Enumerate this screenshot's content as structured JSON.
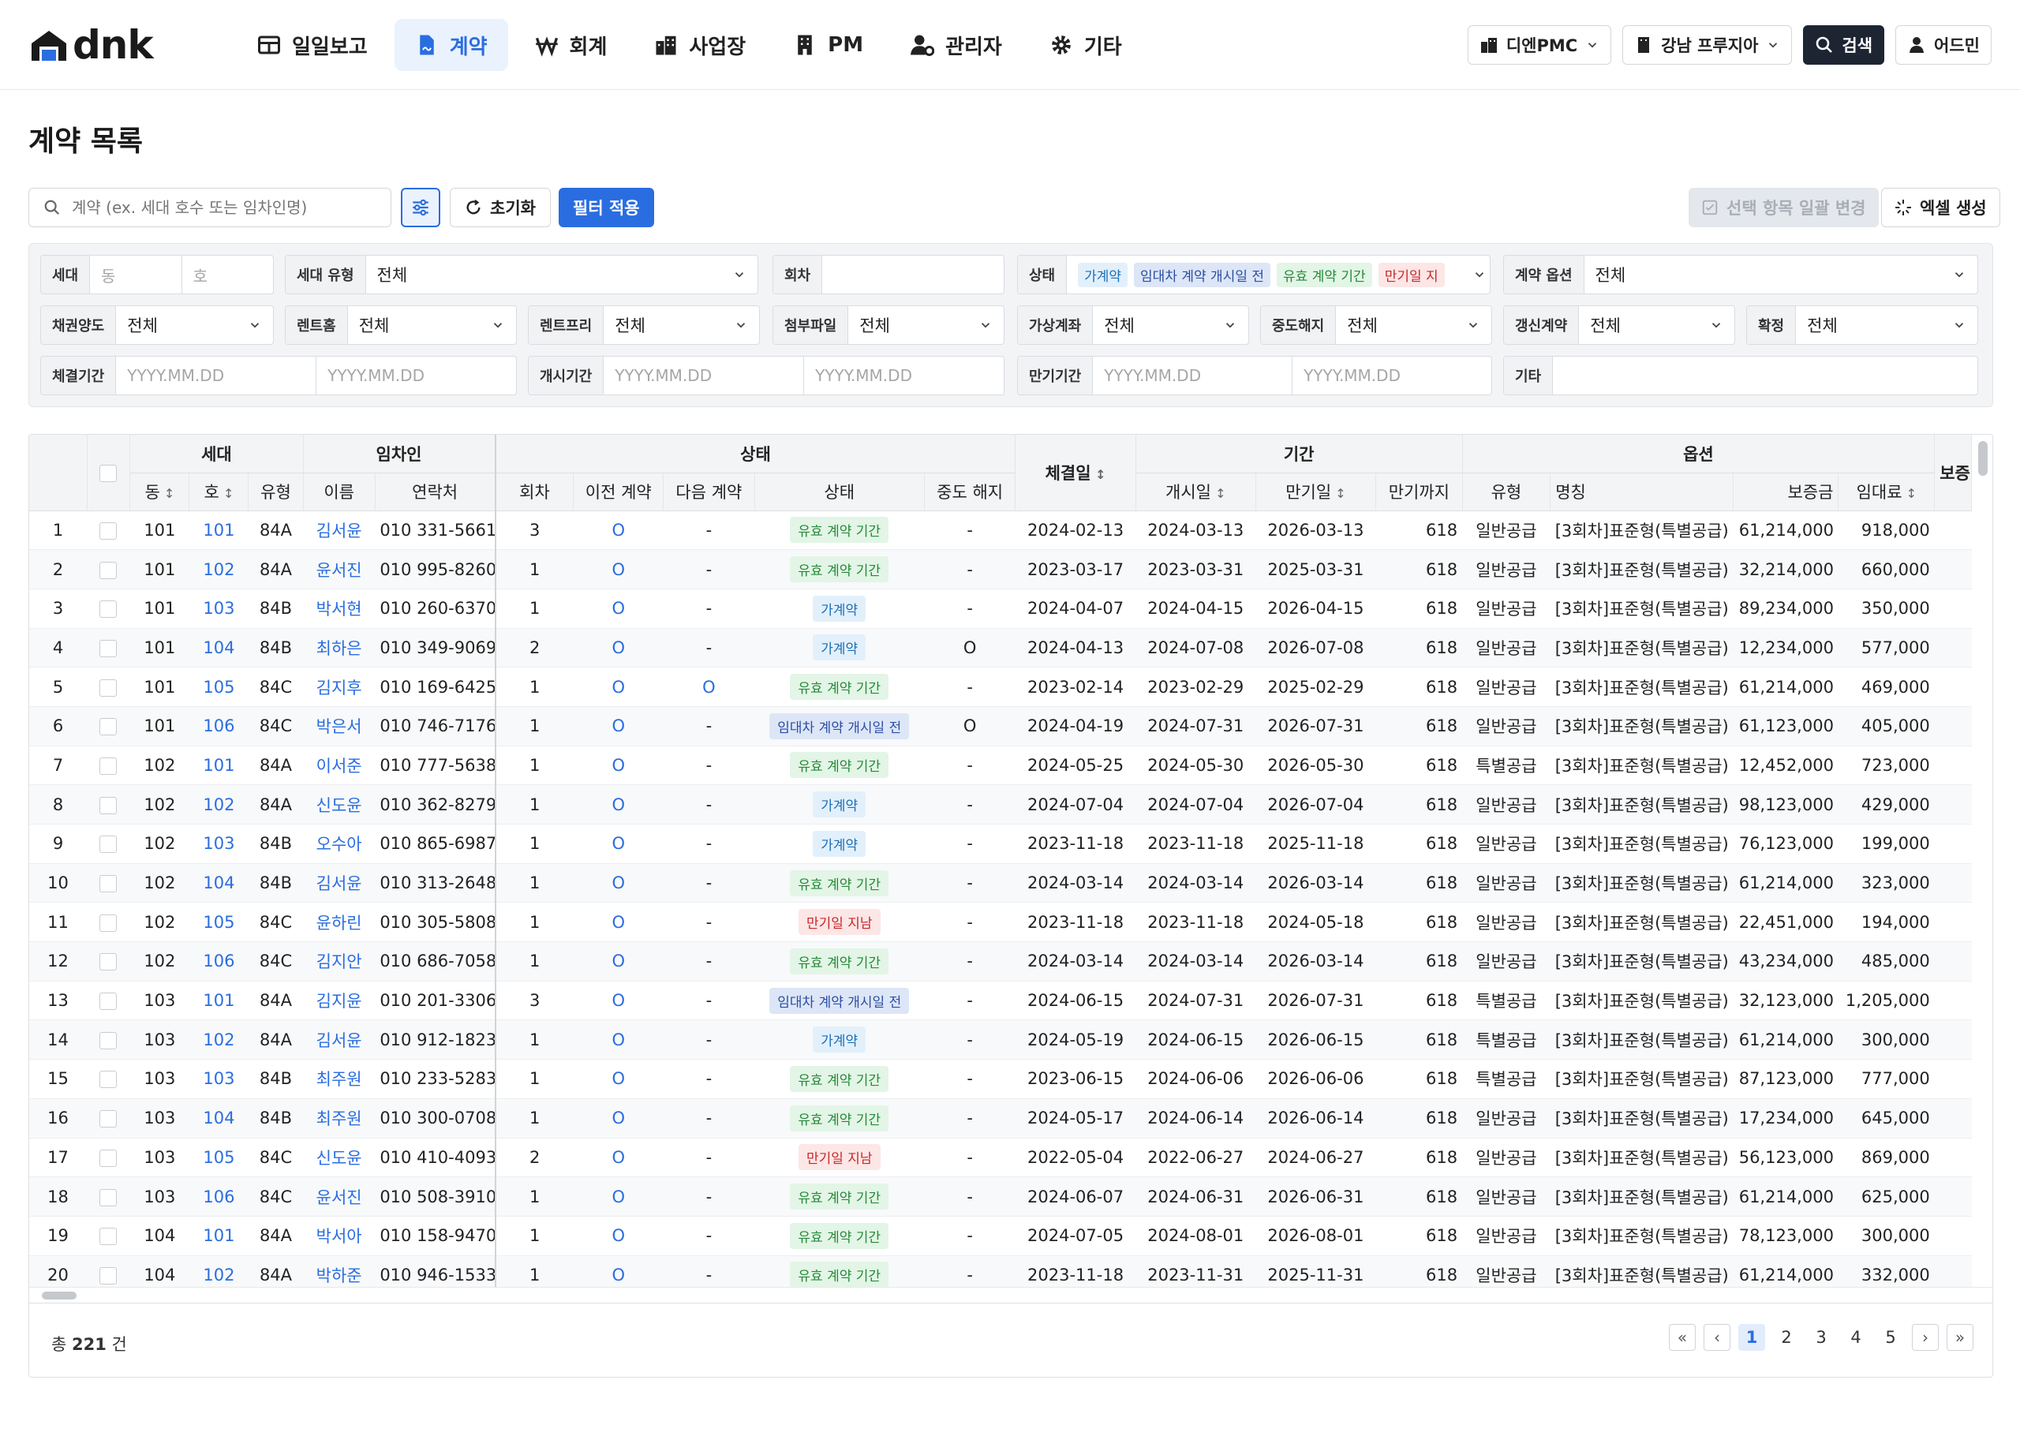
{
  "app": {
    "logo_text": "dnk",
    "nav": [
      {
        "label": "일일보고",
        "icon": "table-icon"
      },
      {
        "label": "계약",
        "icon": "contract-file-icon",
        "active": true
      },
      {
        "label": "회계",
        "icon": "won-icon"
      },
      {
        "label": "사업장",
        "icon": "buildings-icon"
      },
      {
        "label": "PM",
        "icon": "building-icon"
      },
      {
        "label": "관리자",
        "icon": "user-gear-icon"
      },
      {
        "label": "기타",
        "icon": "gear-icon"
      }
    ],
    "company_select": "디엔PMC",
    "site_select": "강남 프루지아",
    "search_label": "검색",
    "user_label": "어드민"
  },
  "page": {
    "title": "계약 목록",
    "search_placeholder": "계약 (ex. 세대 호수 또는 임차인명)",
    "reset_label": "초기화",
    "apply_label": "필터 적용",
    "bulk_label": "선택 항목 일괄 변경",
    "excel_label": "엑셀 생성"
  },
  "filters": {
    "unit_label": "세대",
    "dong_placeholder": "동",
    "ho_placeholder": "호",
    "unit_type_label": "세대 유형",
    "unit_type_value": "전체",
    "round_label": "회차",
    "round_value": "",
    "status_label": "상태",
    "status_tags": [
      "가계약",
      "임대차 계약 개시일 전",
      "유효 계약 기간",
      "만기일 지"
    ],
    "option_label": "계약 옵션",
    "option_value": "전체",
    "assign_label": "채권양도",
    "assign_value": "전체",
    "renthome_label": "렌트홈",
    "renthome_value": "전체",
    "rentfree_label": "렌트프리",
    "rentfree_value": "전체",
    "attach_label": "첨부파일",
    "attach_value": "전체",
    "virtual_label": "가상계좌",
    "virtual_value": "전체",
    "cancel_label": "중도해지",
    "cancel_value": "전체",
    "renew_label": "갱신계약",
    "renew_value": "전체",
    "confirm_label": "확정",
    "confirm_value": "전체",
    "sign_period_label": "체결기간",
    "start_period_label": "개시기간",
    "end_period_label": "만기기간",
    "date_placeholder": "YYYY.MM.DD",
    "etc_label": "기타"
  },
  "table": {
    "groups": {
      "unit": "세대",
      "tenant": "임차인",
      "status": "상태",
      "sign_date": "체결일",
      "period": "기간",
      "option": "옵션",
      "deposit_cut": "보증"
    },
    "columns": {
      "dong": "동",
      "ho": "호",
      "type": "유형",
      "name": "이름",
      "phone": "연락처",
      "round": "회차",
      "prev": "이전 계약",
      "next": "다음 계약",
      "status": "상태",
      "cancel": "중도 해지",
      "start": "개시일",
      "end": "만기일",
      "remain": "만기까지",
      "opt_type": "유형",
      "opt_name": "명칭",
      "deposit": "보증금",
      "rent": "임대료"
    },
    "rows": [
      {
        "no": "1",
        "dong": "101",
        "ho": "101",
        "type": "84A",
        "name": "김서윤",
        "phone": "010 331-5661",
        "round": "3",
        "prev": "O",
        "next": "-",
        "status": "유효 계약 기간",
        "cancel": "-",
        "sign": "2024-02-13",
        "start": "2024-03-13",
        "end": "2026-03-13",
        "remain": "618",
        "opt_type": "일반공급",
        "opt_name": "[3회차]표준형(특별공급)",
        "deposit": "61,214,000",
        "rent": "918,000"
      },
      {
        "no": "2",
        "dong": "101",
        "ho": "102",
        "type": "84A",
        "name": "윤서진",
        "phone": "010 995-8260",
        "round": "1",
        "prev": "O",
        "next": "-",
        "status": "유효 계약 기간",
        "cancel": "-",
        "sign": "2023-03-17",
        "start": "2023-03-31",
        "end": "2025-03-31",
        "remain": "618",
        "opt_type": "일반공급",
        "opt_name": "[3회차]표준형(특별공급)",
        "deposit": "32,214,000",
        "rent": "660,000"
      },
      {
        "no": "3",
        "dong": "101",
        "ho": "103",
        "type": "84B",
        "name": "박서현",
        "phone": "010 260-6370",
        "round": "1",
        "prev": "O",
        "next": "-",
        "status": "가계약",
        "cancel": "-",
        "sign": "2024-04-07",
        "start": "2024-04-15",
        "end": "2026-04-15",
        "remain": "618",
        "opt_type": "일반공급",
        "opt_name": "[3회차]표준형(특별공급)",
        "deposit": "89,234,000",
        "rent": "350,000"
      },
      {
        "no": "4",
        "dong": "101",
        "ho": "104",
        "type": "84B",
        "name": "최하은",
        "phone": "010 349-9069",
        "round": "2",
        "prev": "O",
        "next": "-",
        "status": "가계약",
        "cancel": "O",
        "sign": "2024-04-13",
        "start": "2024-07-08",
        "end": "2026-07-08",
        "remain": "618",
        "opt_type": "일반공급",
        "opt_name": "[3회차]표준형(특별공급)",
        "deposit": "12,234,000",
        "rent": "577,000"
      },
      {
        "no": "5",
        "dong": "101",
        "ho": "105",
        "type": "84C",
        "name": "김지후",
        "phone": "010 169-6425",
        "round": "1",
        "prev": "O",
        "next": "O",
        "status": "유효 계약 기간",
        "cancel": "-",
        "sign": "2023-02-14",
        "start": "2023-02-29",
        "end": "2025-02-29",
        "remain": "618",
        "opt_type": "일반공급",
        "opt_name": "[3회차]표준형(특별공급)",
        "deposit": "61,214,000",
        "rent": "469,000"
      },
      {
        "no": "6",
        "dong": "101",
        "ho": "106",
        "type": "84C",
        "name": "박은서",
        "phone": "010 746-7176",
        "round": "1",
        "prev": "O",
        "next": "-",
        "status": "임대차 계약 개시일 전",
        "cancel": "O",
        "sign": "2024-04-19",
        "start": "2024-07-31",
        "end": "2026-07-31",
        "remain": "618",
        "opt_type": "일반공급",
        "opt_name": "[3회차]표준형(특별공급)",
        "deposit": "61,123,000",
        "rent": "405,000"
      },
      {
        "no": "7",
        "dong": "102",
        "ho": "101",
        "type": "84A",
        "name": "이서준",
        "phone": "010 777-5638",
        "round": "1",
        "prev": "O",
        "next": "-",
        "status": "유효 계약 기간",
        "cancel": "-",
        "sign": "2024-05-25",
        "start": "2024-05-30",
        "end": "2026-05-30",
        "remain": "618",
        "opt_type": "특별공급",
        "opt_name": "[3회차]표준형(특별공급)",
        "deposit": "12,452,000",
        "rent": "723,000"
      },
      {
        "no": "8",
        "dong": "102",
        "ho": "102",
        "type": "84A",
        "name": "신도윤",
        "phone": "010 362-8279",
        "round": "1",
        "prev": "O",
        "next": "-",
        "status": "가계약",
        "cancel": "-",
        "sign": "2024-07-04",
        "start": "2024-07-04",
        "end": "2026-07-04",
        "remain": "618",
        "opt_type": "일반공급",
        "opt_name": "[3회차]표준형(특별공급)",
        "deposit": "98,123,000",
        "rent": "429,000"
      },
      {
        "no": "9",
        "dong": "102",
        "ho": "103",
        "type": "84B",
        "name": "오수아",
        "phone": "010 865-6987",
        "round": "1",
        "prev": "O",
        "next": "-",
        "status": "가계약",
        "cancel": "-",
        "sign": "2023-11-18",
        "start": "2023-11-18",
        "end": "2025-11-18",
        "remain": "618",
        "opt_type": "일반공급",
        "opt_name": "[3회차]표준형(특별공급)",
        "deposit": "76,123,000",
        "rent": "199,000"
      },
      {
        "no": "10",
        "dong": "102",
        "ho": "104",
        "type": "84B",
        "name": "김서윤",
        "phone": "010 313-2648",
        "round": "1",
        "prev": "O",
        "next": "-",
        "status": "유효 계약 기간",
        "cancel": "-",
        "sign": "2024-03-14",
        "start": "2024-03-14",
        "end": "2026-03-14",
        "remain": "618",
        "opt_type": "일반공급",
        "opt_name": "[3회차]표준형(특별공급)",
        "deposit": "61,214,000",
        "rent": "323,000"
      },
      {
        "no": "11",
        "dong": "102",
        "ho": "105",
        "type": "84C",
        "name": "윤하린",
        "phone": "010 305-5808",
        "round": "1",
        "prev": "O",
        "next": "-",
        "status": "만기일 지남",
        "cancel": "-",
        "sign": "2023-11-18",
        "start": "2023-11-18",
        "end": "2024-05-18",
        "remain": "618",
        "opt_type": "일반공급",
        "opt_name": "[3회차]표준형(특별공급)",
        "deposit": "22,451,000",
        "rent": "194,000"
      },
      {
        "no": "12",
        "dong": "102",
        "ho": "106",
        "type": "84C",
        "name": "김지안",
        "phone": "010 686-7058",
        "round": "1",
        "prev": "O",
        "next": "-",
        "status": "유효 계약 기간",
        "cancel": "-",
        "sign": "2024-03-14",
        "start": "2024-03-14",
        "end": "2026-03-14",
        "remain": "618",
        "opt_type": "일반공급",
        "opt_name": "[3회차]표준형(특별공급)",
        "deposit": "43,234,000",
        "rent": "485,000"
      },
      {
        "no": "13",
        "dong": "103",
        "ho": "101",
        "type": "84A",
        "name": "김지윤",
        "phone": "010 201-3306",
        "round": "3",
        "prev": "O",
        "next": "-",
        "status": "임대차 계약 개시일 전",
        "cancel": "-",
        "sign": "2024-06-15",
        "start": "2024-07-31",
        "end": "2026-07-31",
        "remain": "618",
        "opt_type": "특별공급",
        "opt_name": "[3회차]표준형(특별공급)",
        "deposit": "32,123,000",
        "rent": "1,205,000"
      },
      {
        "no": "14",
        "dong": "103",
        "ho": "102",
        "type": "84A",
        "name": "김서윤",
        "phone": "010 912-1823",
        "round": "1",
        "prev": "O",
        "next": "-",
        "status": "가계약",
        "cancel": "-",
        "sign": "2024-05-19",
        "start": "2024-06-15",
        "end": "2026-06-15",
        "remain": "618",
        "opt_type": "특별공급",
        "opt_name": "[3회차]표준형(특별공급)",
        "deposit": "61,214,000",
        "rent": "300,000"
      },
      {
        "no": "15",
        "dong": "103",
        "ho": "103",
        "type": "84B",
        "name": "최주원",
        "phone": "010 233-5283",
        "round": "1",
        "prev": "O",
        "next": "-",
        "status": "유효 계약 기간",
        "cancel": "-",
        "sign": "2023-06-15",
        "start": "2024-06-06",
        "end": "2026-06-06",
        "remain": "618",
        "opt_type": "특별공급",
        "opt_name": "[3회차]표준형(특별공급)",
        "deposit": "87,123,000",
        "rent": "777,000"
      },
      {
        "no": "16",
        "dong": "103",
        "ho": "104",
        "type": "84B",
        "name": "최주원",
        "phone": "010 300-0708",
        "round": "1",
        "prev": "O",
        "next": "-",
        "status": "유효 계약 기간",
        "cancel": "-",
        "sign": "2024-05-17",
        "start": "2024-06-14",
        "end": "2026-06-14",
        "remain": "618",
        "opt_type": "일반공급",
        "opt_name": "[3회차]표준형(특별공급)",
        "deposit": "17,234,000",
        "rent": "645,000"
      },
      {
        "no": "17",
        "dong": "103",
        "ho": "105",
        "type": "84C",
        "name": "신도윤",
        "phone": "010 410-4093",
        "round": "2",
        "prev": "O",
        "next": "-",
        "status": "만기일 지남",
        "cancel": "-",
        "sign": "2022-05-04",
        "start": "2022-06-27",
        "end": "2024-06-27",
        "remain": "618",
        "opt_type": "일반공급",
        "opt_name": "[3회차]표준형(특별공급)",
        "deposit": "56,123,000",
        "rent": "869,000"
      },
      {
        "no": "18",
        "dong": "103",
        "ho": "106",
        "type": "84C",
        "name": "윤서진",
        "phone": "010 508-3910",
        "round": "1",
        "prev": "O",
        "next": "-",
        "status": "유효 계약 기간",
        "cancel": "-",
        "sign": "2024-06-07",
        "start": "2024-06-31",
        "end": "2026-06-31",
        "remain": "618",
        "opt_type": "일반공급",
        "opt_name": "[3회차]표준형(특별공급)",
        "deposit": "61,214,000",
        "rent": "625,000"
      },
      {
        "no": "19",
        "dong": "104",
        "ho": "101",
        "type": "84A",
        "name": "박서아",
        "phone": "010 158-9470",
        "round": "1",
        "prev": "O",
        "next": "-",
        "status": "유효 계약 기간",
        "cancel": "-",
        "sign": "2024-07-05",
        "start": "2024-08-01",
        "end": "2026-08-01",
        "remain": "618",
        "opt_type": "일반공급",
        "opt_name": "[3회차]표준형(특별공급)",
        "deposit": "78,123,000",
        "rent": "300,000"
      },
      {
        "no": "20",
        "dong": "104",
        "ho": "102",
        "type": "84A",
        "name": "박하준",
        "phone": "010 946-1533",
        "round": "1",
        "prev": "O",
        "next": "-",
        "status": "유효 계약 기간",
        "cancel": "-",
        "sign": "2023-11-18",
        "start": "2023-11-31",
        "end": "2025-11-31",
        "remain": "618",
        "opt_type": "일반공급",
        "opt_name": "[3회차]표준형(특별공급)",
        "deposit": "61,214,000",
        "rent": "332,000"
      }
    ]
  },
  "footer": {
    "total_prefix": "총",
    "total_count": "221",
    "total_suffix": "건",
    "pages": [
      "1",
      "2",
      "3",
      "4",
      "5"
    ],
    "current_page": "1"
  }
}
